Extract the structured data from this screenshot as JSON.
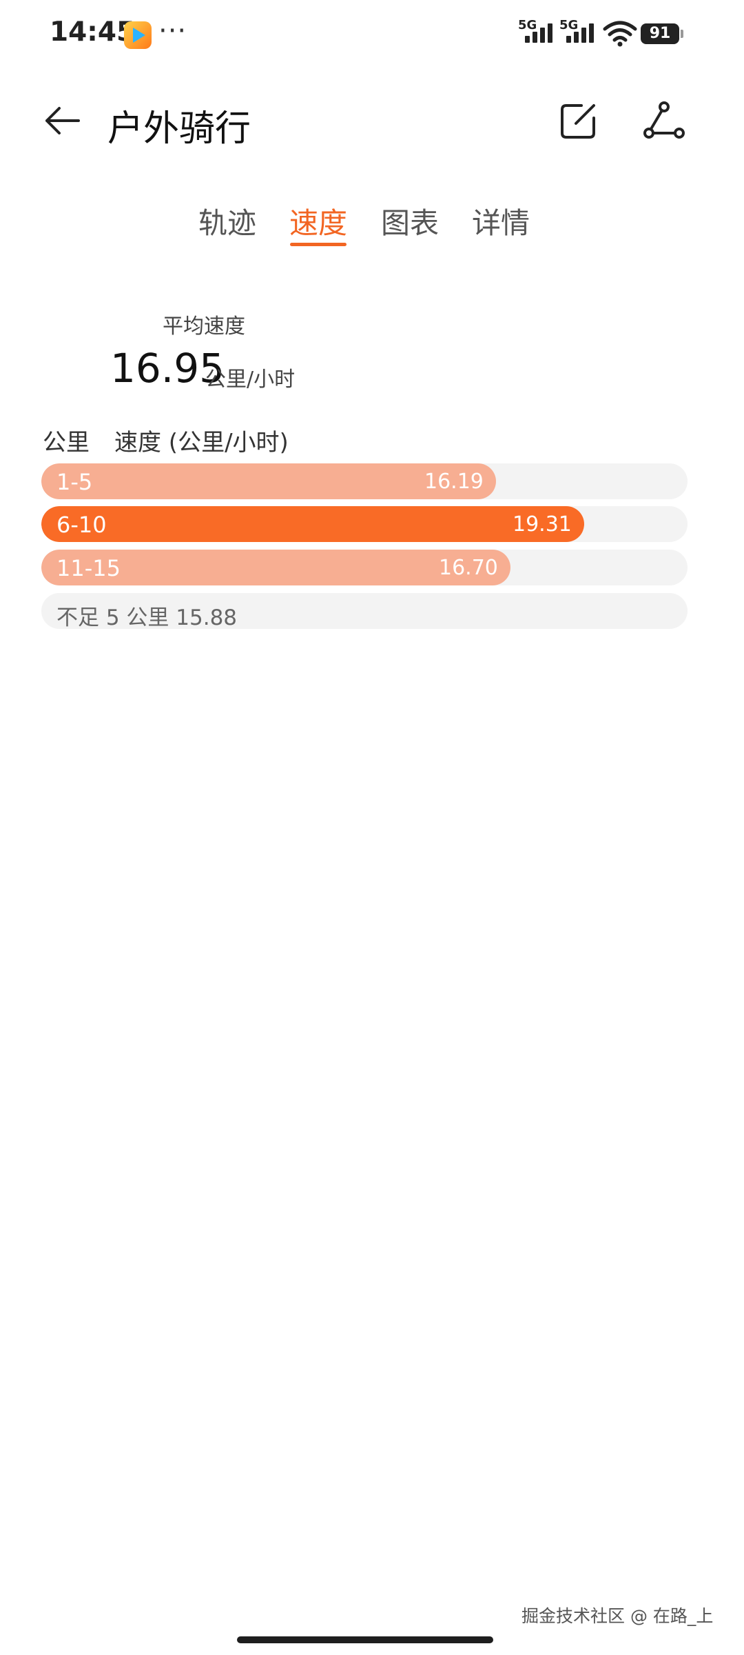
{
  "status_bar": {
    "time": "14:45",
    "more": "···",
    "signal1": "5G",
    "signal2": "5G",
    "battery": "91"
  },
  "header": {
    "title": "户外骑行"
  },
  "tabs": [
    {
      "label": "轨迹",
      "active": false
    },
    {
      "label": "速度",
      "active": true
    },
    {
      "label": "图表",
      "active": false
    },
    {
      "label": "详情",
      "active": false
    }
  ],
  "average": {
    "label": "平均速度",
    "value": "16.95",
    "unit": "公里/小时"
  },
  "chart_data": {
    "type": "bar",
    "column_headers": [
      "公里",
      "速度 (公里/小时)"
    ],
    "categories": [
      "1-5",
      "6-10",
      "11-15"
    ],
    "values": [
      16.19,
      19.31,
      16.7
    ],
    "value_labels": [
      "16.19",
      "19.31",
      "16.70"
    ],
    "highlight_index": 1,
    "footer_label": "不足 5 公里 15.88",
    "colors": {
      "bar": "#f7ae92",
      "highlight": "#f96b26",
      "track": "#f3f3f3"
    }
  },
  "watermark": "掘金技术社区 @ 在路_上",
  "icons": {
    "back": "arrow-left-icon",
    "edit": "edit-note-icon",
    "route": "route-share-icon"
  },
  "colors": {
    "accent": "#f26522"
  }
}
